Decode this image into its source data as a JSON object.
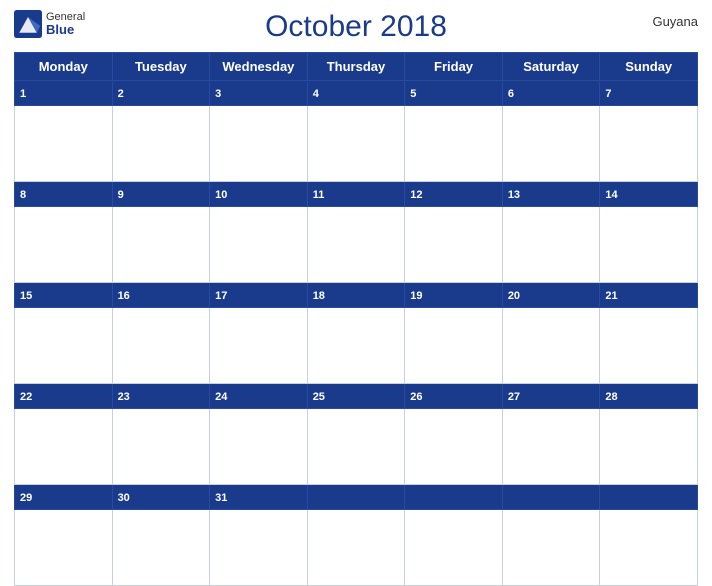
{
  "header": {
    "title": "October 2018",
    "country": "Guyana",
    "logo": {
      "general": "General",
      "blue": "Blue"
    }
  },
  "weekdays": [
    "Monday",
    "Tuesday",
    "Wednesday",
    "Thursday",
    "Friday",
    "Saturday",
    "Sunday"
  ],
  "weeks": [
    {
      "dates": [
        1,
        2,
        3,
        4,
        5,
        6,
        7
      ]
    },
    {
      "dates": [
        8,
        9,
        10,
        11,
        12,
        13,
        14
      ]
    },
    {
      "dates": [
        15,
        16,
        17,
        18,
        19,
        20,
        21
      ]
    },
    {
      "dates": [
        22,
        23,
        24,
        25,
        26,
        27,
        28
      ]
    },
    {
      "dates": [
        29,
        30,
        31,
        null,
        null,
        null,
        null
      ]
    }
  ],
  "colors": {
    "header_bg": "#1a3a8c",
    "header_text": "#ffffff",
    "cell_border": "#c8d0e0",
    "date_num_color": "#1a3a8c"
  }
}
